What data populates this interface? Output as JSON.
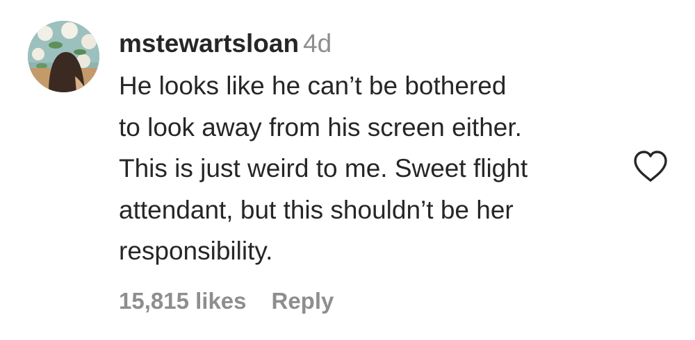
{
  "comment": {
    "username": "mstewartsloan",
    "timestamp": "4d",
    "text_lines": [
      "He looks like he can’t be bothered",
      "to look away from his screen either.",
      "This is just weird to me. Sweet flight",
      "attendant, but this shouldn’t be her",
      "responsibility."
    ],
    "likes_label": "15,815 likes",
    "reply_label": "Reply"
  },
  "icons": {
    "like": "heart-outline-icon",
    "avatar": "profile-photo"
  },
  "colors": {
    "text": "#262626",
    "secondary": "#8e8e8e",
    "background": "#ffffff"
  }
}
